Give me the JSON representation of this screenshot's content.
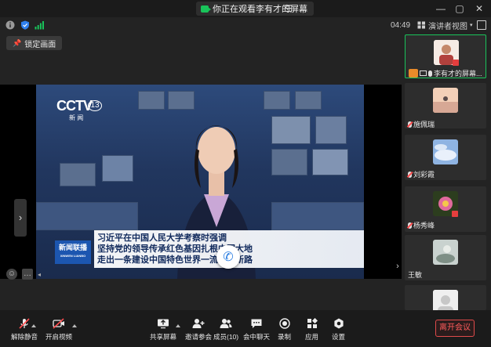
{
  "window": {
    "share_status": "你正在观看李有才的屏幕",
    "share_menu_icon": "list-icon",
    "controls": [
      "minimize-icon",
      "maximize-icon",
      "close-icon"
    ]
  },
  "infobar": {
    "time": "04:49",
    "view_mode": "演讲者视图"
  },
  "lock_button": "锁定画面",
  "broadcast": {
    "channel_logo": "CCTV",
    "channel_number": "13",
    "channel_sub": "新 闻",
    "program_logo": "新闻联播",
    "program_logo_sub": "XINWEN LIANBO",
    "headline_lines": [
      "习近平在中国人民大学考察时强调",
      "坚持党的领导传承红色基因扎根中国大地",
      "走出一条建设中国特色世界一流大学新路"
    ]
  },
  "participants": [
    {
      "name": "李有才的屏幕...",
      "active": true,
      "muted": false
    },
    {
      "name": "施佩瑞",
      "active": false,
      "muted": true
    },
    {
      "name": "刘彩霞",
      "active": false,
      "muted": true
    },
    {
      "name": "杨秀峰",
      "active": false,
      "muted": true
    },
    {
      "name": "王敏",
      "active": false,
      "muted": false
    },
    {
      "name": "",
      "active": false,
      "muted": false
    }
  ],
  "toolbar": {
    "unmute": "解除静音",
    "start_video": "开启视频",
    "share_screen": "共享屏幕",
    "invite": "邀请参会",
    "members": "成员(10)",
    "chat": "会中聊天",
    "record": "录制",
    "apps": "应用",
    "settings": "设置",
    "leave": "离开会议"
  },
  "colors": {
    "accent_green": "#19c35a",
    "leave_red": "#ff5b5b",
    "background": "#232323"
  }
}
